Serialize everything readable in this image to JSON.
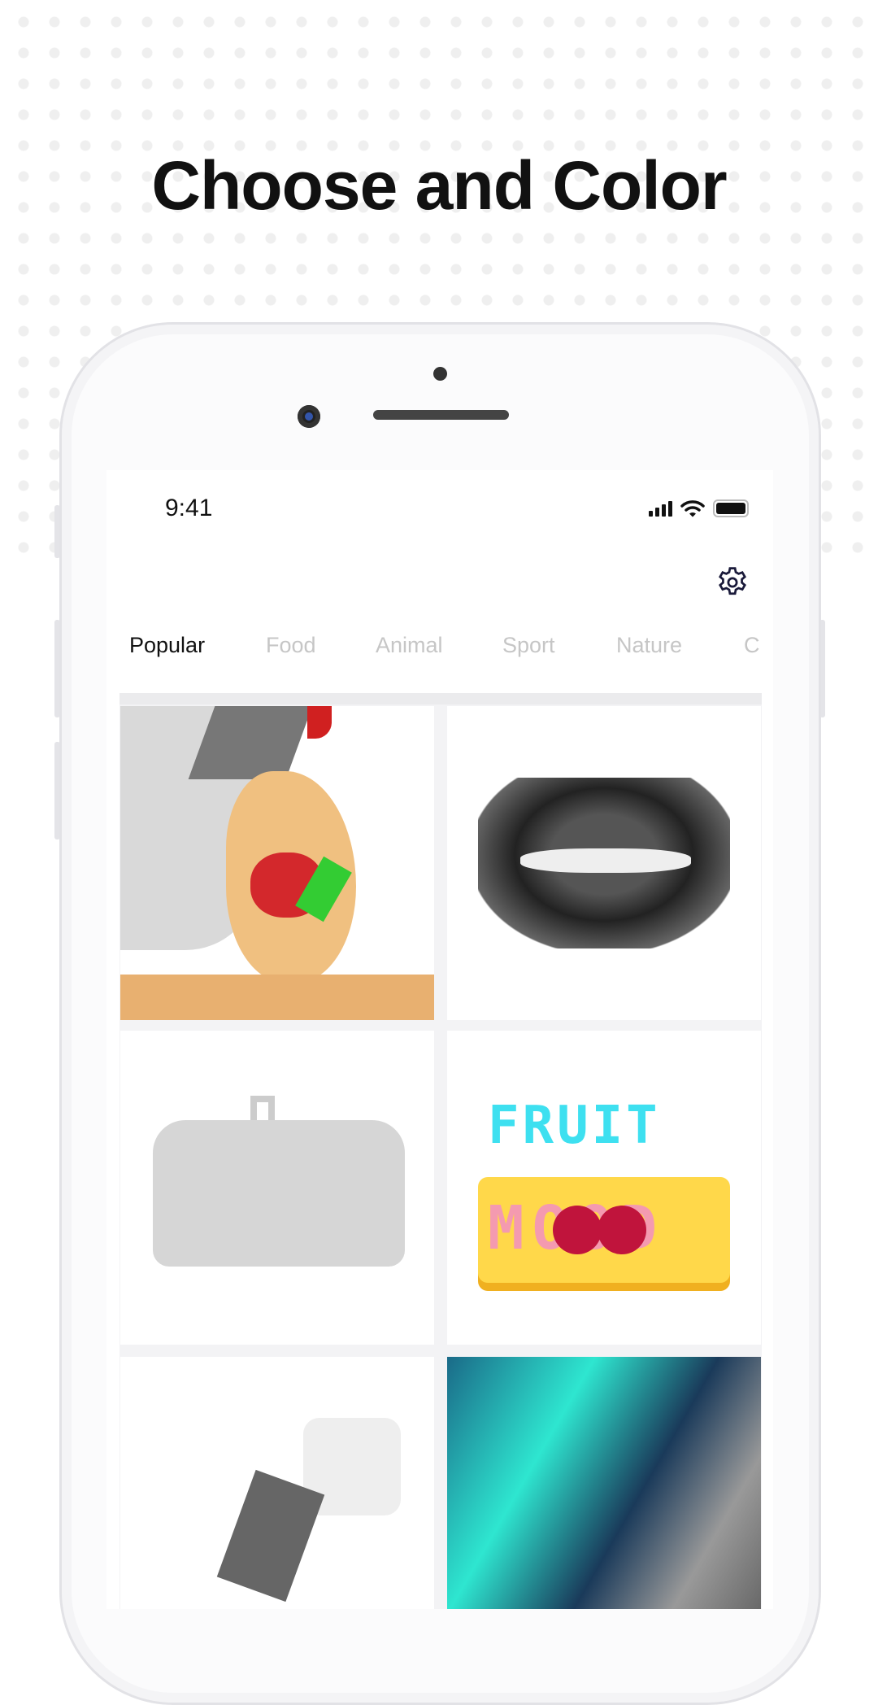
{
  "headline": "Choose and Color",
  "status_bar": {
    "time": "9:41",
    "icons": [
      "signal-icon",
      "wifi-icon",
      "battery-icon"
    ]
  },
  "settings_icon": "gear-icon",
  "tabs": [
    {
      "label": "Popular",
      "active": true
    },
    {
      "label": "Food"
    },
    {
      "label": "Animal"
    },
    {
      "label": "Sport"
    },
    {
      "label": "Nature"
    },
    {
      "label": "C"
    }
  ],
  "colors": {
    "active_tab": "#111111",
    "inactive_tab": "#c6c6c6",
    "grid_bg": "#f3f3f5"
  },
  "gallery": [
    {
      "name": "woman-eating-strawberry"
    },
    {
      "name": "lips"
    },
    {
      "name": "purse"
    },
    {
      "name": "fruit-mood",
      "text": [
        "FRUIT",
        "MOOD"
      ]
    },
    {
      "name": "sketch-object"
    },
    {
      "name": "aurora"
    }
  ]
}
